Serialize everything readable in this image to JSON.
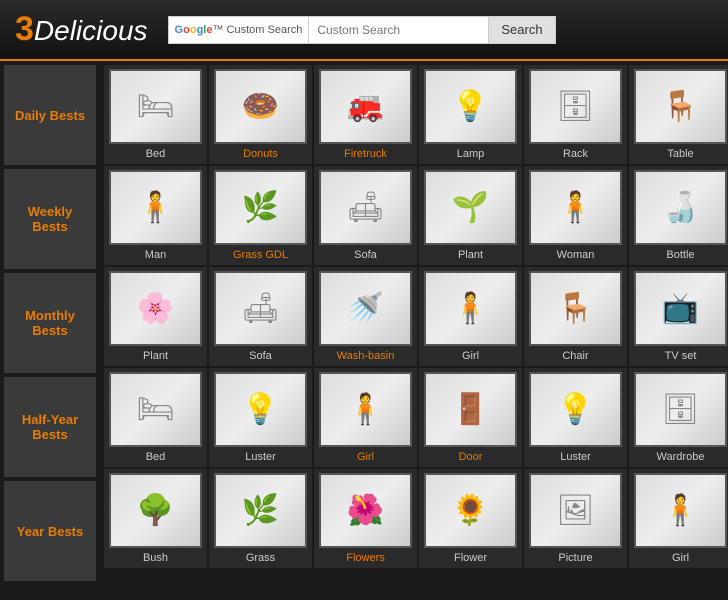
{
  "header": {
    "logo_three": "3",
    "logo_rest": "Delicious",
    "search_placeholder": "Custom Search",
    "search_button_label": "Search",
    "google_label": "Google™ Custom Search"
  },
  "sidebar": {
    "items": [
      {
        "id": "daily",
        "label": "Daily Bests"
      },
      {
        "id": "weekly",
        "label": "Weekly Bests"
      },
      {
        "id": "monthly",
        "label": "Monthly Bests"
      },
      {
        "id": "halfyear",
        "label": "Half-Year Bests"
      },
      {
        "id": "year",
        "label": "Year Bests"
      }
    ]
  },
  "rows": [
    {
      "items": [
        {
          "label": "Bed",
          "color": "normal",
          "emoji": "🛏"
        },
        {
          "label": "Donuts",
          "color": "orange",
          "emoji": "🍩"
        },
        {
          "label": "Firetruck",
          "color": "orange",
          "emoji": "🚒"
        },
        {
          "label": "Lamp",
          "color": "normal",
          "emoji": "💡"
        },
        {
          "label": "Rack",
          "color": "normal",
          "emoji": "🗄"
        },
        {
          "label": "Table",
          "color": "normal",
          "emoji": "🪑"
        }
      ]
    },
    {
      "items": [
        {
          "label": "Man",
          "color": "normal",
          "emoji": "🧍"
        },
        {
          "label": "Grass GDL",
          "color": "orange",
          "emoji": "🌿"
        },
        {
          "label": "Sofa",
          "color": "normal",
          "emoji": "🛋"
        },
        {
          "label": "Plant",
          "color": "normal",
          "emoji": "🌱"
        },
        {
          "label": "Woman",
          "color": "normal",
          "emoji": "🧍"
        },
        {
          "label": "Bottle",
          "color": "normal",
          "emoji": "🍶"
        }
      ]
    },
    {
      "items": [
        {
          "label": "Plant",
          "color": "normal",
          "emoji": "🌸"
        },
        {
          "label": "Sofa",
          "color": "normal",
          "emoji": "🛋"
        },
        {
          "label": "Wash-basin",
          "color": "orange",
          "emoji": "🚿"
        },
        {
          "label": "Girl",
          "color": "normal",
          "emoji": "🧍"
        },
        {
          "label": "Chair",
          "color": "normal",
          "emoji": "🪑"
        },
        {
          "label": "TV set",
          "color": "normal",
          "emoji": "📺"
        }
      ]
    },
    {
      "items": [
        {
          "label": "Bed",
          "color": "normal",
          "emoji": "🛏"
        },
        {
          "label": "Luster",
          "color": "normal",
          "emoji": "💡"
        },
        {
          "label": "Girl",
          "color": "orange",
          "emoji": "🧍"
        },
        {
          "label": "Door",
          "color": "orange",
          "emoji": "🚪"
        },
        {
          "label": "Luster",
          "color": "normal",
          "emoji": "💡"
        },
        {
          "label": "Wardrobe",
          "color": "normal",
          "emoji": "🗄"
        }
      ]
    },
    {
      "items": [
        {
          "label": "Bush",
          "color": "normal",
          "emoji": "🌳"
        },
        {
          "label": "Grass",
          "color": "normal",
          "emoji": "🌿"
        },
        {
          "label": "Flowers",
          "color": "orange",
          "emoji": "🌺"
        },
        {
          "label": "Flower",
          "color": "normal",
          "emoji": "🌻"
        },
        {
          "label": "Picture",
          "color": "normal",
          "emoji": "🖼"
        },
        {
          "label": "Girl",
          "color": "normal",
          "emoji": "🧍"
        }
      ]
    }
  ]
}
